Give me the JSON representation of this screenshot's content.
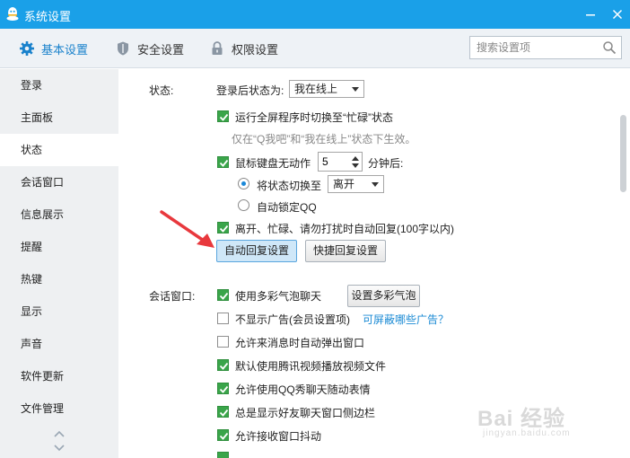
{
  "window": {
    "title": "系统设置",
    "accent": "#1aa0e8"
  },
  "tabs": [
    {
      "label": "基本设置",
      "icon": "gear-icon",
      "active": true
    },
    {
      "label": "安全设置",
      "icon": "shield-icon",
      "active": false
    },
    {
      "label": "权限设置",
      "icon": "lock-icon",
      "active": false
    }
  ],
  "search": {
    "placeholder": "搜索设置项"
  },
  "sidebar": {
    "items": [
      "登录",
      "主面板",
      "状态",
      "会话窗口",
      "信息展示",
      "提醒",
      "热键",
      "显示",
      "声音",
      "软件更新",
      "文件管理"
    ],
    "active_index": 2
  },
  "status_section": {
    "label": "状态:",
    "login_status_label": "登录后状态为:",
    "login_status_value": "我在线上",
    "fullscreen_label": "运行全屏程序时切换至“忙碌”状态",
    "fullscreen_checked": true,
    "fullscreen_hint": "仅在“Q我吧”和“我在线上”状态下生效。",
    "idle_label": "鼠标键盘无动作",
    "idle_minutes": "5",
    "idle_unit": "分钟后:",
    "idle_checked": true,
    "switch_label": "将状态切换至",
    "switch_value": "离开",
    "switch_selected": true,
    "autolock_label": "自动锁定QQ",
    "autolock_selected": false,
    "autoreply_label": "离开、忙碌、请勿打扰时自动回复(100字以内)",
    "autoreply_checked": true,
    "autoreply_button": "自动回复设置",
    "quickreply_button": "快捷回复设置"
  },
  "chat_section": {
    "label": "会话窗口:",
    "items": [
      {
        "label": "使用多彩气泡聊天",
        "checked": true
      },
      {
        "label": "不显示广告(会员设置项)",
        "checked": false
      },
      {
        "label": "允许来消息时自动弹出窗口",
        "checked": false
      },
      {
        "label": "默认使用腾讯视频播放视频文件",
        "checked": true
      },
      {
        "label": "允许使用QQ秀聊天随动表情",
        "checked": true
      },
      {
        "label": "总是显示好友聊天窗口侧边栏",
        "checked": true
      },
      {
        "label": "允许接收窗口抖动",
        "checked": true
      }
    ],
    "bubble_button": "设置多彩气泡",
    "ads_link": "可屏蔽哪些广告？"
  },
  "watermark": {
    "text": "Bai 经验",
    "url": "jingyan.baidu.com"
  },
  "colors": {
    "check_green": "#3aa54a",
    "link_blue": "#1a8ad4",
    "annotation_red": "#e8383d"
  }
}
